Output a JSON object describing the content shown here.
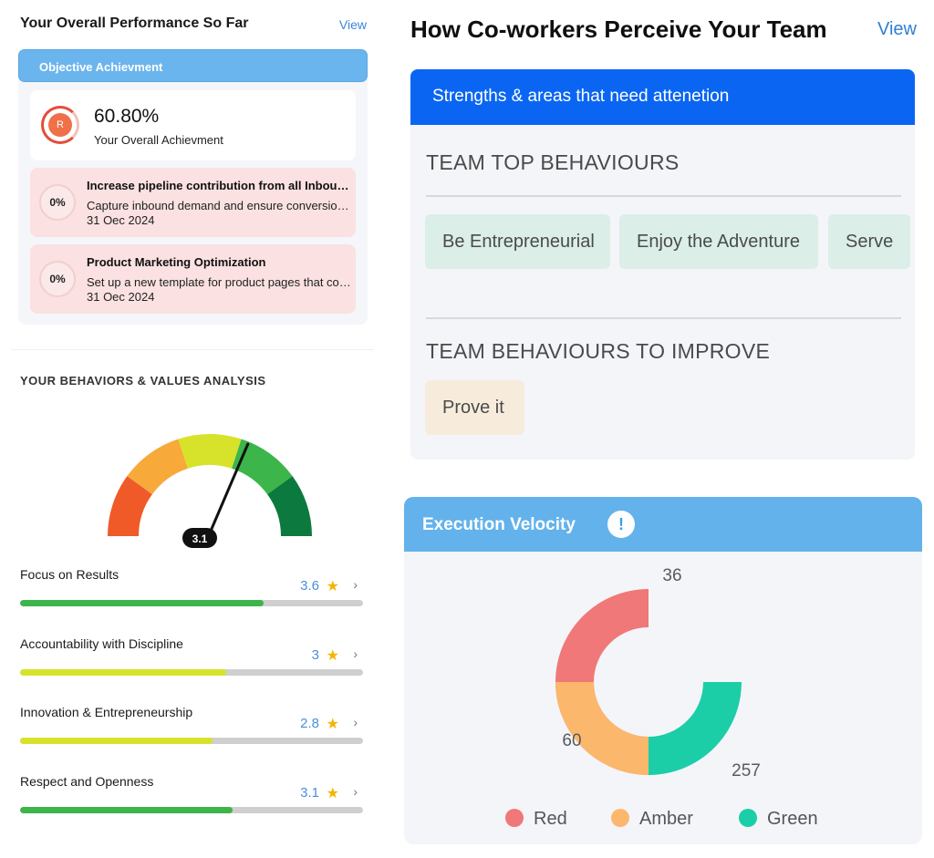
{
  "performance": {
    "title": "Your Overall Performance So Far",
    "view_label": "View",
    "objective_header": "Objective Achievment",
    "overall": {
      "avatar_letter": "R",
      "value": "60.80%",
      "label": "Your Overall Achievment"
    },
    "goals": [
      {
        "percent": "0%",
        "title": "Increase pipeline contribution from all Inbound Channels",
        "desc": "Capture inbound demand and ensure conversion to pipeline",
        "date": "31 Oec 2024"
      },
      {
        "percent": "0%",
        "title": "Product Marketing Optimization",
        "desc": "Set up a new template for product pages that converts better",
        "date": "31 Oec 2024"
      }
    ]
  },
  "behaviors": {
    "title": "YOUR BEHAVIORS & VALUES ANALYSIS",
    "gauge_value": "3.1",
    "gauge_needle_fraction": 0.62,
    "gauge_colors": [
      "#f05a28",
      "#f7a93a",
      "#d7e32a",
      "#3cb54a",
      "#0c7a3e"
    ],
    "items": [
      {
        "name": "Focus on Results",
        "score": "3.6",
        "fill_fraction": 0.71,
        "color": "#3cb54a"
      },
      {
        "name": "Accountability with Discipline",
        "score": "3",
        "fill_fraction": 0.6,
        "color": "#d7e32a"
      },
      {
        "name": "Innovation & Entrepreneurship",
        "score": "2.8",
        "fill_fraction": 0.56,
        "color": "#d7e32a"
      },
      {
        "name": "Respect and Openness",
        "score": "3.1",
        "fill_fraction": 0.62,
        "color": "#3cb54a"
      }
    ],
    "star_glyph": "★",
    "chevron_glyph": "›"
  },
  "team": {
    "title": "How Co-workers Perceive Your Team",
    "view_label": "View",
    "header": "Strengths & areas that need attenetion",
    "top_title": "TEAM TOP BEHAVIOURS",
    "top_chips": [
      "Be Entrepreneurial",
      "Enjoy the Adventure",
      "Serve"
    ],
    "improve_title": "TEAM BEHAVIOURS TO IMPROVE",
    "improve_chips": [
      "Prove it"
    ]
  },
  "velocity": {
    "title": "Execution Velocity",
    "info_glyph": "!"
  },
  "chart_data": {
    "type": "pie",
    "title": "Execution Velocity",
    "categories": [
      "Red",
      "Amber",
      "Green"
    ],
    "values": [
      36,
      60,
      257
    ],
    "colors": [
      "#f07878",
      "#fbb86c",
      "#1bcea8"
    ],
    "legend_position": "bottom",
    "slice_start_degrees": [
      270,
      180,
      90
    ],
    "slice_sweep_degrees": [
      180,
      90,
      90
    ]
  }
}
